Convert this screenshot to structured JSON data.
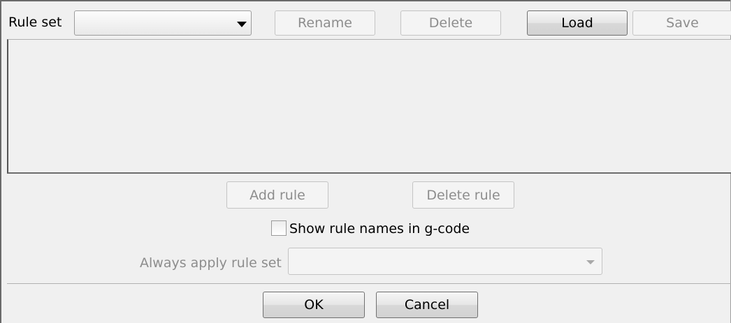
{
  "toolbar": {
    "rule_set_label": "Rule set",
    "rule_set_value": "",
    "rename_label": "Rename",
    "delete_label": "Delete",
    "load_label": "Load",
    "save_label": "Save"
  },
  "rules": {
    "add_rule_label": "Add rule",
    "delete_rule_label": "Delete rule",
    "show_names_label": "Show rule names in g-code",
    "show_names_checked": false,
    "always_apply_label": "Always apply rule set",
    "always_apply_value": ""
  },
  "dialog": {
    "ok_label": "OK",
    "cancel_label": "Cancel"
  },
  "icons": {
    "rule_set_dropdown": "chevron-down-icon",
    "always_apply_dropdown": "chevron-down-icon"
  }
}
